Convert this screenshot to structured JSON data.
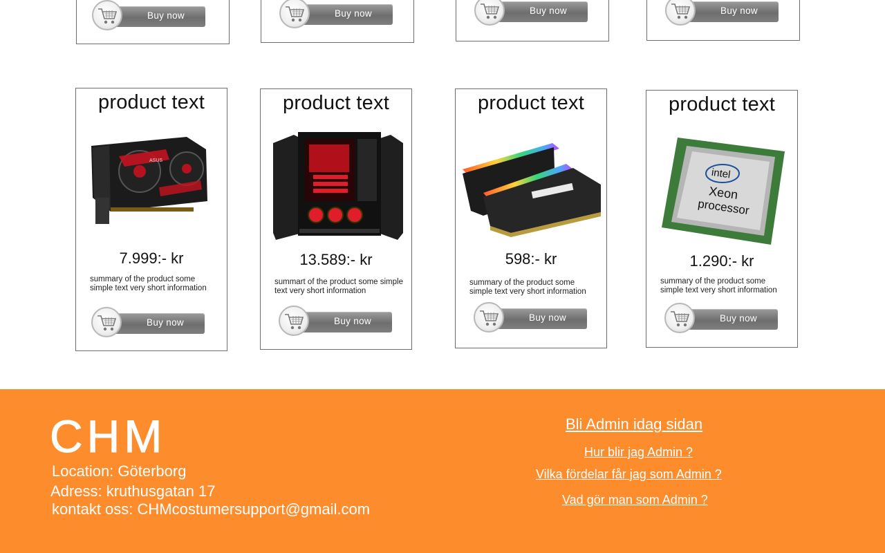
{
  "products": [
    {
      "title": "product text",
      "price": "7.999:- kr",
      "summary": "summary of the product some simple text very short information",
      "buy_label": "Buy now",
      "image": "graphics-card"
    },
    {
      "title": "product text",
      "price": "13.589:- kr",
      "summary": "summart of the product some simple text very short information",
      "buy_label": "Buy now",
      "image": "gaming-pc"
    },
    {
      "title": "product text",
      "price": "598:- kr",
      "summary": "summary of the product some simple text very short information",
      "buy_label": "Buy now",
      "image": "ram-modules"
    },
    {
      "title": "product text",
      "price": "1.290:- kr",
      "summary": "summary of the product some simple text very short information",
      "buy_label": "Buy now",
      "image": "cpu"
    }
  ],
  "top_row": [
    {
      "buy_label": "Buy now"
    },
    {
      "buy_label": "Buy now"
    },
    {
      "buy_label": "Buy now"
    },
    {
      "buy_label": "Buy now"
    }
  ],
  "cpu_logo": {
    "brand": "intel",
    "line1": "Xeon",
    "line2": "processor"
  },
  "footer": {
    "logo": "CHM",
    "location": "Location: Göterborg",
    "address": "Adress: kruthusgatan 17",
    "contact": "kontakt oss: CHMcostumersupport@gmail.com",
    "admin_heading": " Bli Admin idag sidan",
    "links": [
      "Hur blir jag Admin ?",
      "Vilka fördelar får jag som Admin ?",
      "Vad gör  man som Admin ?"
    ]
  },
  "colors": {
    "footer_bg": "#fc8c2c",
    "button": "#7b7b7b"
  }
}
